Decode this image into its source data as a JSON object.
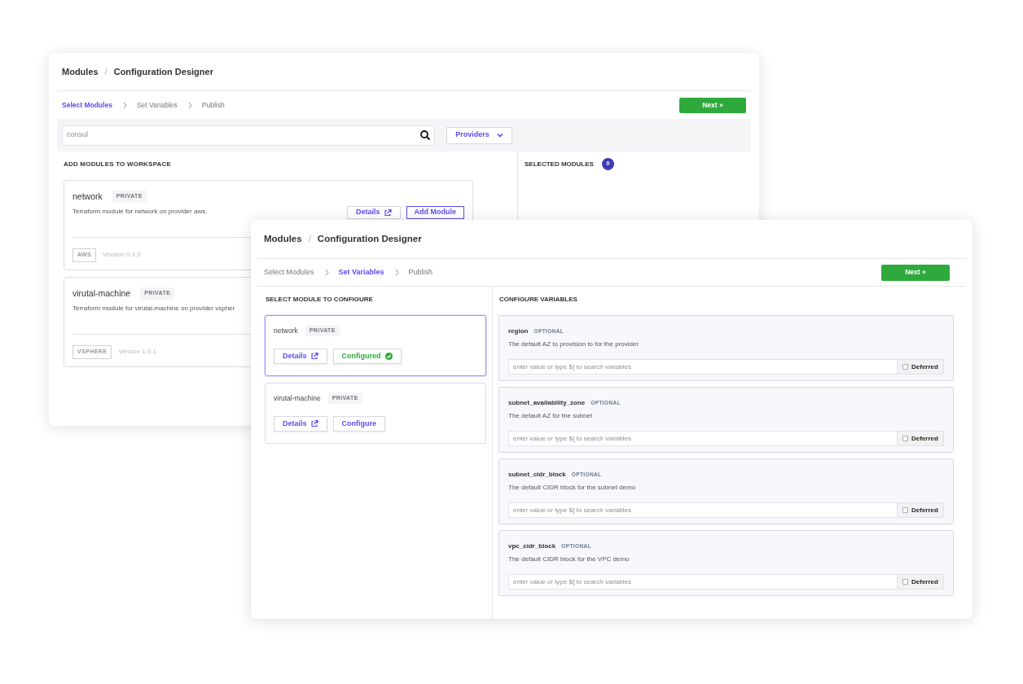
{
  "back_window": {
    "breadcrumb": {
      "items": [
        "Modules",
        "Configuration Designer"
      ],
      "separator": "/"
    },
    "steps": [
      {
        "label": "Select Modules",
        "selected": true
      },
      {
        "label": "Set Variables",
        "selected": false
      },
      {
        "label": "Publish",
        "selected": false
      }
    ],
    "next_button": "Next »",
    "search": {
      "placeholder": "consul"
    },
    "providers_button": "Providers",
    "left_heading": "ADD MODULES TO WORKSPACE",
    "right_heading": "SELECTED MODULES",
    "selected_count": "0",
    "modules": [
      {
        "name": "network",
        "badge": "PRIVATE",
        "description": "Terraform module for network on provider aws.",
        "actions": [
          {
            "label": "Details",
            "kind": "details"
          },
          {
            "label": "Add Module",
            "kind": "add"
          }
        ],
        "provider": "AWS",
        "version": "Version 0.1.0"
      },
      {
        "name": "virutal-machine",
        "badge": "PRIVATE",
        "description": "Terraform module for virutal-machine on provider vspher",
        "provider": "VSPHERE",
        "version": "Version 1.0.1"
      }
    ]
  },
  "front_window": {
    "breadcrumb": {
      "items": [
        "Modules",
        "Configuration Designer"
      ],
      "separator": "/"
    },
    "steps": [
      {
        "label": "Select Modules",
        "selected": false
      },
      {
        "label": "Set Variables",
        "selected": true
      },
      {
        "label": "Publish",
        "selected": false
      }
    ],
    "next_button": "Next »",
    "left_heading": "SELECT MODULE TO CONFIGURE",
    "right_heading": "CONFIGURE VARIABLES",
    "modules": [
      {
        "name": "network",
        "badge": "PRIVATE",
        "selected": true,
        "actions": [
          {
            "label": "Details",
            "kind": "details"
          },
          {
            "label": "Configured",
            "kind": "configured"
          }
        ]
      },
      {
        "name": "virutal-machine",
        "badge": "PRIVATE",
        "selected": false,
        "actions": [
          {
            "label": "Details",
            "kind": "details"
          },
          {
            "label": "Configure",
            "kind": "configure"
          }
        ]
      }
    ],
    "variables": [
      {
        "name": "region",
        "tag": "OPTIONAL",
        "description": "The default AZ to provision to for the provider",
        "placeholder": "enter value or type ${ to search variables",
        "deferred_label": "Deferred",
        "checked": false
      },
      {
        "name": "subnet_availability_zone",
        "tag": "OPTIONAL",
        "description": "The default AZ for the subnet",
        "placeholder": "enter value or type ${ to search variables",
        "deferred_label": "Deferred",
        "checked": false
      },
      {
        "name": "subnet_cidr_block",
        "tag": "OPTIONAL",
        "description": "The default CIDR block for the subnet demo",
        "placeholder": "enter value or type ${ to search variables",
        "deferred_label": "Deferred",
        "checked": false
      },
      {
        "name": "vpc_cidr_block",
        "tag": "OPTIONAL",
        "description": "The default CIDR block for the VPC demo",
        "placeholder": "enter value or type ${ to search variables",
        "deferred_label": "Deferred",
        "checked": false
      }
    ]
  }
}
